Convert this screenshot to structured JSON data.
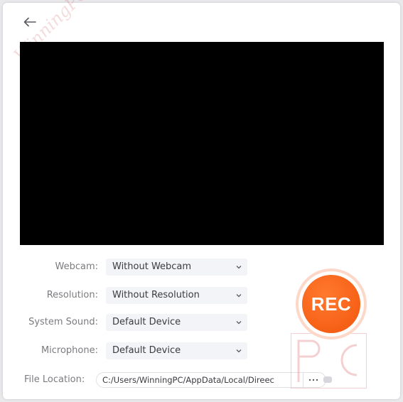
{
  "watermark": {
    "text": "WinningPC"
  },
  "header": {
    "back_icon": "arrow-left-icon"
  },
  "settings": [
    {
      "key": "webcam",
      "label": "Webcam:",
      "value": "Without Webcam"
    },
    {
      "key": "resolution",
      "label": "Resolution:",
      "value": "Without Resolution"
    },
    {
      "key": "system_sound",
      "label": "System Sound:",
      "value": "Default Device"
    },
    {
      "key": "microphone",
      "label": "Microphone:",
      "value": "Default Device"
    }
  ],
  "file_location": {
    "label": "File Location:",
    "path": "C:/Users/WinningPC/AppData/Local/Direec",
    "more_label": "···"
  },
  "rec_button": {
    "label": "REC"
  },
  "logo": {
    "text": "PC"
  },
  "colors": {
    "accent": "#f2550c",
    "preview_bg": "#000000",
    "label": "#7b7b80",
    "select_bg": "#f3f4f8"
  }
}
